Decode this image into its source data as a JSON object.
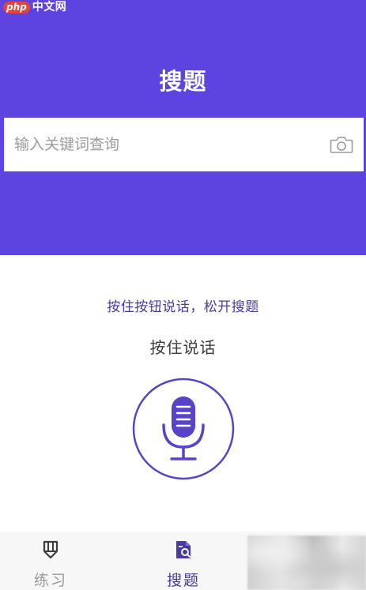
{
  "watermark": {
    "badge": "php",
    "text": "中文网"
  },
  "header": {
    "title": "搜题"
  },
  "search": {
    "placeholder": "输入关键词查询",
    "value": ""
  },
  "voice": {
    "hint": "按住按钮说话，松开搜题",
    "press_label": "按住说话"
  },
  "tabbar": {
    "tabs": [
      {
        "label": "练习",
        "icon": "pencil-icon",
        "active": false
      },
      {
        "label": "搜题",
        "icon": "search-document-icon",
        "active": true
      }
    ]
  },
  "colors": {
    "brand": "#5d43e0",
    "accent_text": "#4a3aa8",
    "inactive_tab": "#9a9a9a",
    "tabbar_bg": "#f7f7f7"
  }
}
